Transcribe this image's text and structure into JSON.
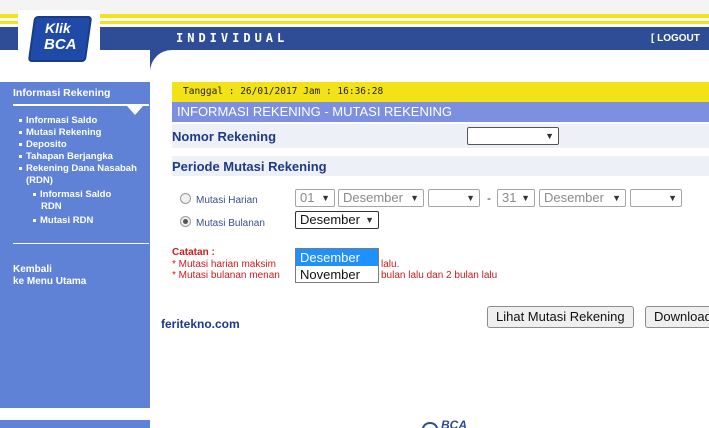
{
  "header": {
    "logo_line1": "Klik",
    "logo_line2": "BCA",
    "band_title": "INDIVIDUAL",
    "logout_label": "[ LOGOUT"
  },
  "sidebar": {
    "heading": "Informasi Rekening",
    "items": [
      {
        "label": "Informasi Saldo"
      },
      {
        "label": "Mutasi Rekening"
      },
      {
        "label": "Deposito"
      },
      {
        "label": "Tahapan Berjangka"
      },
      {
        "label": "Rekening Dana Nasabah"
      },
      {
        "label": "(RDN)"
      }
    ],
    "sub_items": [
      {
        "label": "Informasi Saldo"
      },
      {
        "label": "RDN"
      },
      {
        "label": "Mutasi RDN"
      }
    ],
    "back_line1": "Kembali",
    "back_line2": "ke Menu Utama"
  },
  "main": {
    "date_line": "Tanggal : 26/01/2017 Jam : 16:36:28",
    "page_title": "INFORMASI REKENING - MUTASI REKENING",
    "nomor_label": "Nomor Rekening",
    "nomor_value": "",
    "periode_label": "Periode Mutasi Rekening",
    "harian": {
      "label": "Mutasi Harian",
      "checked": false,
      "from_day": "01",
      "from_month": "Desember",
      "from_year": "",
      "separator": "-",
      "to_day": "31",
      "to_month": "Desember",
      "to_year": ""
    },
    "bulanan": {
      "label": "Mutasi Bulanan",
      "checked": true,
      "month": "Desember",
      "options": [
        "Desember",
        "November"
      ]
    },
    "catatan_title": "Catatan :",
    "catatan_lines": [
      {
        "before": "* Mutasi harian maksim",
        "after": "lalu."
      },
      {
        "before": "* Mutasi bulanan menan",
        "after": "bulan lalu dan 2 bulan lalu"
      }
    ],
    "watermark": "feritekno.com",
    "view_button": "Lihat Mutasi Rekening",
    "download_button": "Download"
  },
  "footer": {
    "logo_text": "BCA"
  },
  "colors": {
    "brand_blue": "#2e4d96",
    "sidebar_blue": "#5f82d6",
    "accent_yellow": "#f3e316",
    "note_red": "#d01a1a"
  }
}
